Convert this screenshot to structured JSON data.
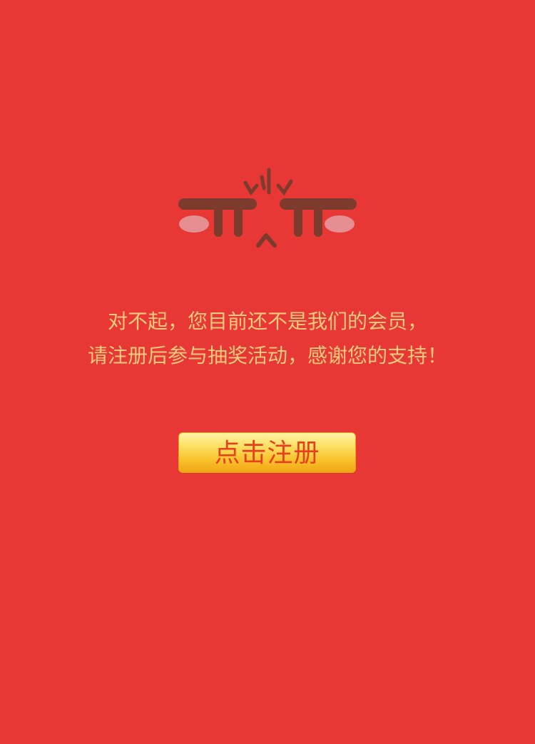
{
  "colors": {
    "background": "#e83835",
    "message_text": "#f7c97c",
    "button_text": "#e8401f",
    "face_feature": "#7c3b2d",
    "cheek": "#e58f92"
  },
  "illustration": {
    "icon": "crying-face-icon"
  },
  "message": {
    "line1": "对不起，您目前还不是我们的会员，",
    "line2": "请注册后参与抽奖活动，感谢您的支持！"
  },
  "register_button": {
    "label": "点击注册"
  }
}
